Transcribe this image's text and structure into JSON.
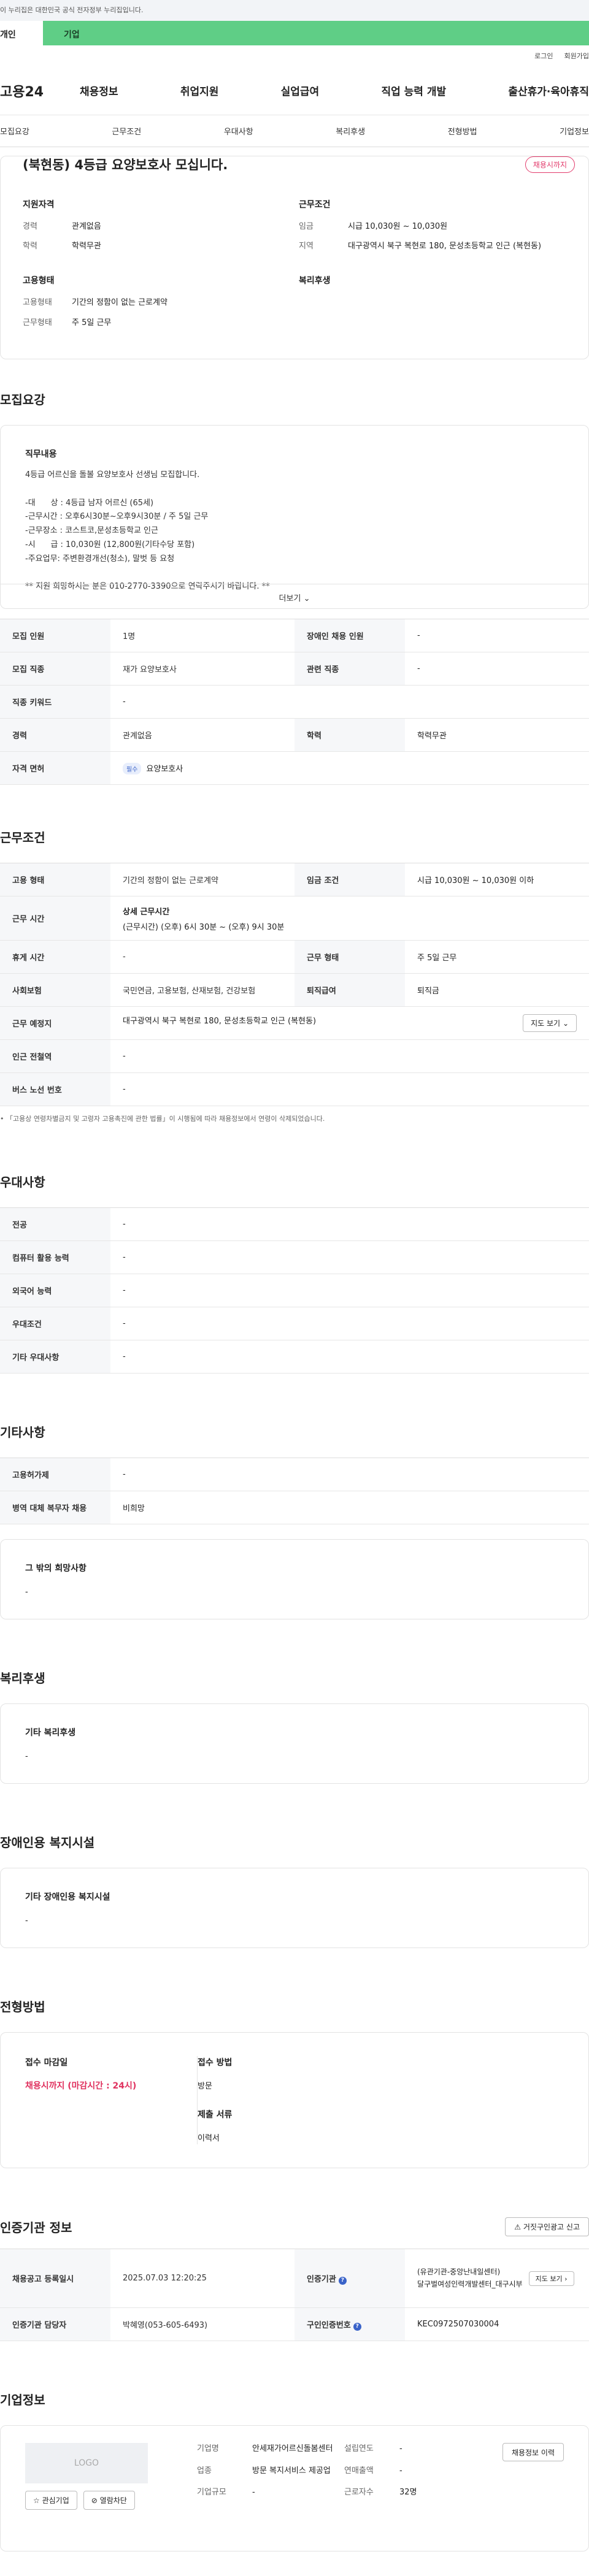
{
  "gov_notice": "이 누리집은 대한민국 공식 전자정부 누리집입니다.",
  "top_tabs": {
    "personal": "개인",
    "company": "기업"
  },
  "util": {
    "login": "로그인",
    "join": "회원가입"
  },
  "logo": "고용24",
  "gnb": [
    "채용정보",
    "취업지원",
    "실업급여",
    "직업 능력 개발",
    "출산휴가·육아휴직"
  ],
  "anchors": [
    "모집요강",
    "근무조건",
    "우대사항",
    "복리후생",
    "전형방법",
    "기업정보"
  ],
  "summary": {
    "title": "(북현동) 4등급 요양보호사 모십니다.",
    "badge": "채용시까지",
    "qual_title": "지원자격",
    "career_k": "경력",
    "career_v": "관계없음",
    "edu_k": "학력",
    "edu_v": "학력무관",
    "work_title": "근무조건",
    "wage_k": "임금",
    "wage_v": "시급 10,030원 ~ 10,030원",
    "region_k": "지역",
    "region_v": "대구광역시 북구 복현로 180, 문성초등학교 인근 (복현동)",
    "emp_title": "고용형태",
    "emp_k": "고용형태",
    "emp_v": "기간의 정함이 없는 근로계약",
    "days_k": "근무형태",
    "days_v": "주 5일 근무",
    "welfare_title": "복리후생"
  },
  "recruit": {
    "title": "모집요강",
    "duty_title": "직무내용",
    "duty_text": "4등급 어르신을 돌볼 요양보호사 선생님 모집합니다.\n\n-대      상 : 4등급 남자 어르신 (65세)\n-근무시간 : 오후6시30분~오후9시30분 / 주 5일 근무\n-근무장소 : 코스트코,문성초등학교 인근\n-시      급 : 10,030원 (12,800원(기타수당 포함)\n-주요업무: 주변환경개선(청소), 말벗 등 요청\n\n** 지원 희망하시는 분은 010-2770-3390으로 연락주시기 바랍니다. **",
    "more": "더보기",
    "rows": [
      {
        "k1": "모집 인원",
        "v1": "1명",
        "k2": "장애인 채용 인원",
        "v2": "-"
      },
      {
        "k1": "모집 직종",
        "v1": "재가 요양보호사",
        "k2": "관련 직종",
        "v2": "-"
      },
      {
        "k1": "직종 키워드",
        "v1": "-"
      },
      {
        "k1": "경력",
        "v1": "관계없음",
        "k2": "학력",
        "v2": "학력무관"
      },
      {
        "k1": "자격 면허",
        "pill": "필수",
        "v1": "요양보호사"
      }
    ]
  },
  "work": {
    "title": "근무조건",
    "emp_k": "고용 형태",
    "emp_v": "기간의 정함이 없는 근로계약",
    "wage_k": "임금 조건",
    "wage_v": "시급 10,030원 ~ 10,030원 이하",
    "time_k": "근무 시간",
    "time_v1": "상세 근무시간",
    "time_v2": "(근무시간) (오후) 6시 30분 ~ (오후) 9시 30분",
    "rest_k": "휴게 시간",
    "rest_v": "-",
    "type_k": "근무 형태",
    "type_v": "주 5일 근무",
    "ins_k": "사회보험",
    "ins_v": "국민연금, 고용보험, 산재보험, 건강보험",
    "ret_k": "퇴직급여",
    "ret_v": "퇴직금",
    "loc_k": "근무 예정지",
    "loc_v": "대구광역시 북구 복현로 180, 문성초등학교 인근 (복현동)",
    "map_btn": "지도 보기",
    "subway_k": "인근 전철역",
    "subway_v": "-",
    "bus_k": "버스 노선 번호",
    "bus_v": "-",
    "note": "「고용상 연령차별금지 및 고령자 고용촉진에 관한 법률」이 시행됨에 따라 채용정보에서 연령이 삭제되었습니다."
  },
  "pref": {
    "title": "우대사항",
    "rows": [
      {
        "k": "전공",
        "v": "-"
      },
      {
        "k": "컴퓨터 활용 능력",
        "v": "-"
      },
      {
        "k": "외국어 능력",
        "v": "-"
      },
      {
        "k": "우대조건",
        "v": "-"
      },
      {
        "k": "기타 우대사항",
        "v": "-"
      }
    ]
  },
  "etc": {
    "title": "기타사항",
    "rows": [
      {
        "k": "고용허가제",
        "v": "-"
      },
      {
        "k": "병역 대체 복무자 채용",
        "v": "비희망"
      }
    ],
    "other_title": "그 밖의 희망사항",
    "other_v": "-"
  },
  "welfare": {
    "title": "복리후생",
    "sub": "기타 복리후생",
    "v": "-"
  },
  "disabled": {
    "title": "장애인용 복지시설",
    "sub": "기타 장애인용 복지시설",
    "v": "-"
  },
  "apply": {
    "title": "전형방법",
    "deadline_k": "접수 마감일",
    "deadline_v": "채용시까지 (마감시간 : 24시)",
    "method_k": "접수 방법",
    "method_v": "방문",
    "docs_k": "제출 서류",
    "docs_v": "이력서"
  },
  "cert": {
    "title": "인증기관 정보",
    "report_btn": "거짓구인광고 신고",
    "reg_k": "채용공고 등록일시",
    "reg_v": "2025.07.03 12:20:25",
    "org_k": "인증기관",
    "org_v": "(유관기관-중앙난내일센터)\n달구벌여성인력개발센터_대구시부",
    "view_btn": "지도 보기",
    "mgr_k": "인증기관 담당자",
    "mgr_v": "박혜영(053-605-6493)",
    "id_k": "구인인증번호",
    "id_v": "KEC0972507030004"
  },
  "company": {
    "title": "기업정보",
    "logo": "LOGO",
    "fav_btn": "관심기업",
    "block_btn": "열람차단",
    "name_k": "기업명",
    "name_v": "안세재가어르신돌봄센터",
    "ind_k": "업종",
    "ind_v": "방문 복지서비스 제공업",
    "scale_k": "기업규모",
    "scale_v": "-",
    "est_k": "설립연도",
    "est_v": "-",
    "sales_k": "연매출액",
    "sales_v": "-",
    "emp_k": "근로자수",
    "emp_v": "32명",
    "corp_btn": "채용정보 이력"
  }
}
